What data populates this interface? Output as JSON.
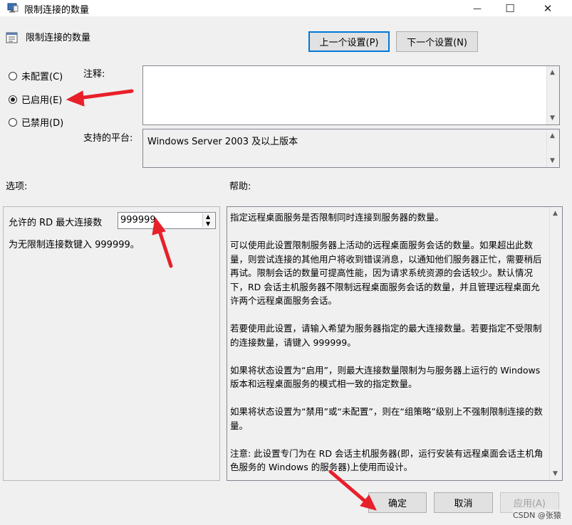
{
  "window": {
    "title": "限制连接的数量",
    "header_title": "限制连接的数量",
    "minimize_glyph": "—",
    "maximize_glyph": "☐",
    "close_glyph": "✕"
  },
  "nav": {
    "prev_label": "上一个设置(P)",
    "next_label": "下一个设置(N)"
  },
  "state": {
    "options": [
      {
        "label": "未配置(C)",
        "checked": false
      },
      {
        "label": "已启用(E)",
        "checked": true
      },
      {
        "label": "已禁用(D)",
        "checked": false
      }
    ]
  },
  "comment": {
    "label": "注释:",
    "value": ""
  },
  "platform": {
    "label": "支持的平台:",
    "value": "Windows Server 2003 及以上版本"
  },
  "options_panel": {
    "label": "选项:",
    "max_conn_label": "允许的 RD 最大连接数",
    "max_conn_value": "999999",
    "hint": "为无限制连接数键入 999999。"
  },
  "help": {
    "label": "帮助:",
    "paragraphs": [
      "指定远程桌面服务是否限制同时连接到服务器的数量。",
      "可以使用此设置限制服务器上活动的远程桌面服务会话的数量。如果超出此数量，则尝试连接的其他用户将收到错误消息，以通知他们服务器正忙，需要稍后再试。限制会话的数量可提高性能，因为请求系统资源的会话较少。默认情况下，RD 会话主机服务器不限制远程桌面服务会话的数量，并且管理远程桌面允许两个远程桌面服务会话。",
      "若要使用此设置，请输入希望为服务器指定的最大连接数量。若要指定不受限制的连接数量，请键入 999999。",
      "如果将状态设置为“启用”，则最大连接数量限制为与服务器上运行的 Windows 版本和远程桌面服务的模式相一致的指定数量。",
      "如果将状态设置为“禁用”或“未配置”，则在“组策略”级别上不强制限制连接的数量。",
      "注意: 此设置专门为在 RD 会话主机服务器(即，运行安装有远程桌面会话主机角色服务的 Windows 的服务器)上使用而设计。"
    ]
  },
  "footer": {
    "ok_label": "确定",
    "cancel_label": "取消",
    "apply_label": "应用(A)",
    "watermark": "CSDN @张猿"
  },
  "colors": {
    "annotation_arrow": "#e8202a",
    "focus_border": "#0078d7"
  }
}
